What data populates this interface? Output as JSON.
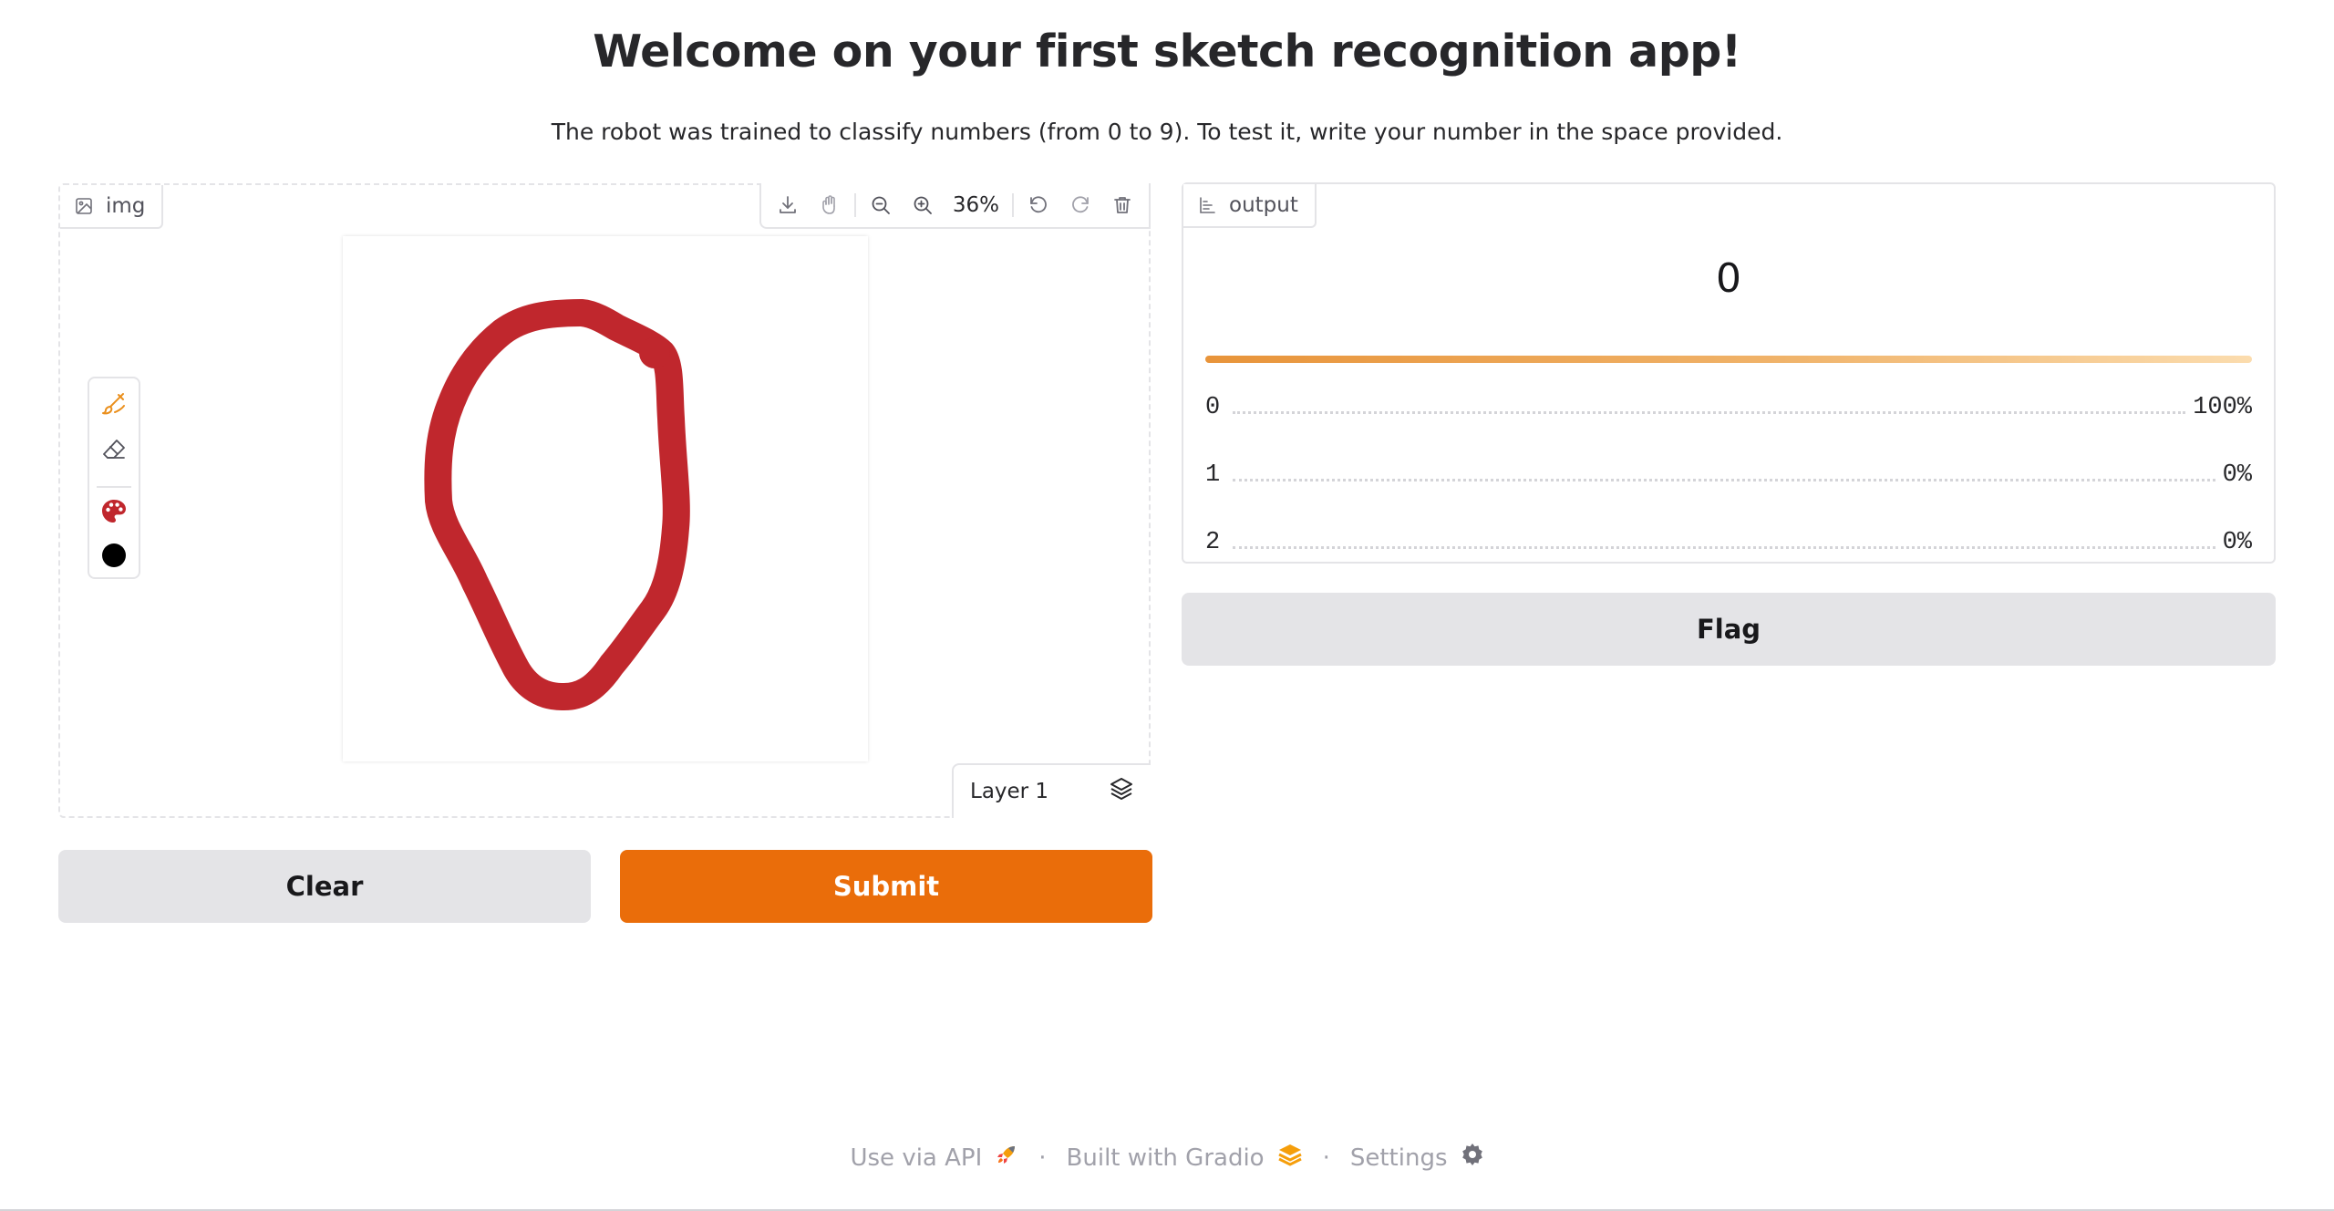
{
  "header": {
    "title": "Welcome on your first sketch recognition app!",
    "subtitle": "The robot was trained to classify numbers (from 0 to 9). To test it, write your number in the space provided."
  },
  "editor": {
    "label": "img",
    "zoom": "36%",
    "layer_label": "Layer 1",
    "brush_color": "#c0272d",
    "secondary_color": "#000000",
    "toolbar_icons": [
      "download-icon",
      "pan-icon",
      "zoom-out-icon",
      "zoom-in-icon",
      "undo-icon",
      "redo-icon",
      "trash-icon"
    ]
  },
  "buttons": {
    "clear": "Clear",
    "submit": "Submit",
    "flag": "Flag"
  },
  "output": {
    "label": "output",
    "prediction": "0",
    "top_confidence": 1.0,
    "rows": [
      {
        "label": "0",
        "value": "100%"
      },
      {
        "label": "1",
        "value": "0%"
      },
      {
        "label": "2",
        "value": "0%"
      }
    ]
  },
  "footer": {
    "api": "Use via API",
    "built": "Built with Gradio",
    "settings": "Settings",
    "separator": "·"
  },
  "colors": {
    "accent": "#ea6d0a",
    "secondary_button": "#e4e4e7"
  }
}
